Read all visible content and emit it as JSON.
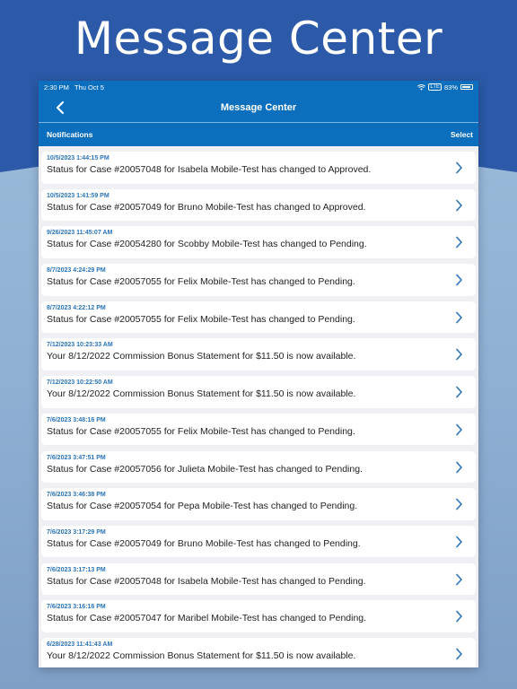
{
  "hero": {
    "title": "Message Center"
  },
  "status_bar": {
    "time": "2:30 PM",
    "date": "Thu Oct 5",
    "lte": "LTE",
    "battery": "83%"
  },
  "nav": {
    "title": "Message Center",
    "back_icon": "chevron-left-icon"
  },
  "section": {
    "label": "Notifications",
    "select_label": "Select"
  },
  "colors": {
    "brand_blue": "#0b6fbe",
    "hero_blue": "#2c5aa8",
    "date_blue": "#2a74b8"
  },
  "notifications": [
    {
      "date": "10/5/2023 1:44:15 PM",
      "message": "Status for Case #20057048 for Isabela Mobile-Test has changed to Approved."
    },
    {
      "date": "10/5/2023 1:41:59 PM",
      "message": "Status for Case #20057049 for Bruno Mobile-Test has changed to Approved."
    },
    {
      "date": "9/26/2023 11:45:07 AM",
      "message": "Status for Case #20054280 for Scobby Mobile-Test has changed to Pending."
    },
    {
      "date": "8/7/2023 4:24:29 PM",
      "message": "Status for Case #20057055 for Felix Mobile-Test has changed to Pending."
    },
    {
      "date": "8/7/2023 4:22:12 PM",
      "message": "Status for Case #20057055 for Felix Mobile-Test has changed to Pending."
    },
    {
      "date": "7/12/2023 10:23:33 AM",
      "message": "Your 8/12/2022 Commission Bonus Statement for $11.50 is now available."
    },
    {
      "date": "7/12/2023 10:22:50 AM",
      "message": "Your 8/12/2022 Commission Bonus Statement for $11.50 is now available."
    },
    {
      "date": "7/6/2023 3:48:16 PM",
      "message": "Status for Case #20057055 for Felix Mobile-Test has changed to Pending."
    },
    {
      "date": "7/6/2023 3:47:51 PM",
      "message": "Status for Case #20057056 for Julieta Mobile-Test has changed to Pending."
    },
    {
      "date": "7/6/2023 3:46:38 PM",
      "message": "Status for Case #20057054 for Pepa Mobile-Test has changed to Pending."
    },
    {
      "date": "7/6/2023 3:17:29 PM",
      "message": "Status for Case #20057049 for Bruno Mobile-Test has changed to Pending."
    },
    {
      "date": "7/6/2023 3:17:13 PM",
      "message": "Status for Case #20057048 for Isabela Mobile-Test has changed to Pending."
    },
    {
      "date": "7/6/2023 3:16:16 PM",
      "message": "Status for Case #20057047 for Maribel Mobile-Test has changed to Pending."
    },
    {
      "date": "6/28/2023 11:41:43 AM",
      "message": "Your 8/12/2022 Commission Bonus Statement for $11.50 is now available."
    }
  ]
}
